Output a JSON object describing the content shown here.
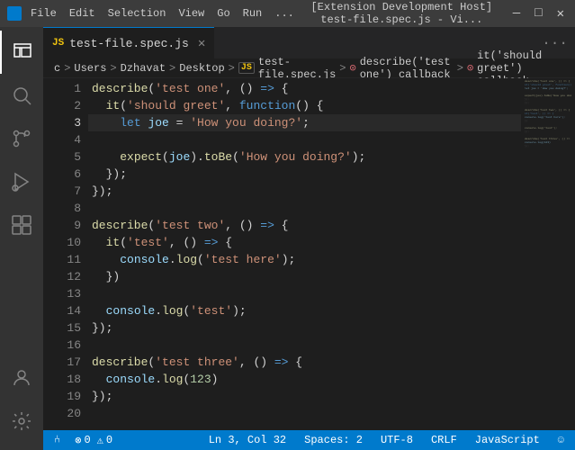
{
  "titlebar": {
    "menu_items": [
      "File",
      "Edit",
      "Selection",
      "View",
      "Go",
      "Run"
    ],
    "more": "...",
    "center": "[Extension Development Host]  test-file.spec.js - Vi...",
    "controls": [
      "—",
      "□",
      "✕"
    ]
  },
  "tabs": [
    {
      "label": "test-file.spec.js",
      "active": true
    }
  ],
  "breadcrumb": {
    "items": [
      "c",
      "Users",
      "Dzhavat",
      "Desktop",
      "JS",
      "test-file.spec.js",
      "describe('test one') callback",
      "it('should greet') callback"
    ]
  },
  "code": {
    "lines": [
      {
        "num": 1,
        "content": "describe('test one', () => {"
      },
      {
        "num": 2,
        "content": "  it('should greet', function() {"
      },
      {
        "num": 3,
        "content": "    let joe = 'How you doing?';"
      },
      {
        "num": 4,
        "content": ""
      },
      {
        "num": 5,
        "content": "    expect(joe).toBe('How you doing?');"
      },
      {
        "num": 6,
        "content": "  });"
      },
      {
        "num": 7,
        "content": "});"
      },
      {
        "num": 8,
        "content": ""
      },
      {
        "num": 9,
        "content": "describe('test two', () => {"
      },
      {
        "num": 10,
        "content": "  it('test', () => {"
      },
      {
        "num": 11,
        "content": "    console.log('test here');"
      },
      {
        "num": 12,
        "content": "  })"
      },
      {
        "num": 13,
        "content": ""
      },
      {
        "num": 14,
        "content": "  console.log('test');"
      },
      {
        "num": 15,
        "content": "});"
      },
      {
        "num": 16,
        "content": ""
      },
      {
        "num": 17,
        "content": "describe('test three', () => {"
      },
      {
        "num": 18,
        "content": "  console.log(123)"
      },
      {
        "num": 19,
        "content": "});"
      },
      {
        "num": 20,
        "content": ""
      }
    ]
  },
  "statusbar": {
    "left": {
      "git": "⑃",
      "errors": "0",
      "warnings": "0"
    },
    "right": {
      "ln_col": "Ln 3, Col 32",
      "spaces": "Spaces: 2",
      "encoding": "UTF-8",
      "line_ending": "CRLF",
      "language": "JavaScript",
      "feedback": "☺"
    }
  },
  "activity_bar": {
    "items": [
      "explorer",
      "search",
      "source-control",
      "run-debug",
      "extensions"
    ],
    "bottom": [
      "accounts",
      "settings"
    ]
  }
}
